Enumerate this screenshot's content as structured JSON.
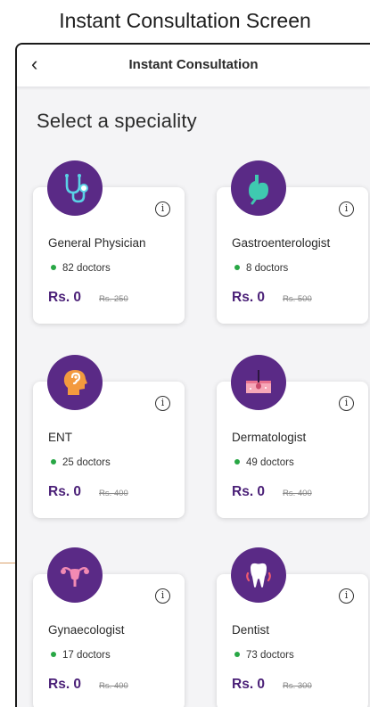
{
  "caption": "Instant Consultation Screen",
  "appbar": {
    "back_icon": "‹",
    "title": "Instant Consultation"
  },
  "section_title": "Select a speciality",
  "accent_color": "#5a2a86",
  "specialities": [
    {
      "name": "General Physician",
      "doctors": "82 doctors",
      "price": "Rs. 0",
      "old_price": "Rs. 250",
      "icon": "stethoscope-icon"
    },
    {
      "name": "Gastroenterologist",
      "doctors": "8 doctors",
      "price": "Rs. 0",
      "old_price": "Rs. 500",
      "icon": "stomach-icon"
    },
    {
      "name": "ENT",
      "doctors": "25 doctors",
      "price": "Rs. 0",
      "old_price": "Rs. 400",
      "icon": "ear-head-icon"
    },
    {
      "name": "Dermatologist",
      "doctors": "49 doctors",
      "price": "Rs. 0",
      "old_price": "Rs. 400",
      "icon": "skin-icon"
    },
    {
      "name": "Gynaecologist",
      "doctors": "17 doctors",
      "price": "Rs. 0",
      "old_price": "Rs. 400",
      "icon": "uterus-icon"
    },
    {
      "name": "Dentist",
      "doctors": "73 doctors",
      "price": "Rs. 0",
      "old_price": "Rs. 300",
      "icon": "tooth-icon"
    }
  ],
  "info_icon": "i"
}
